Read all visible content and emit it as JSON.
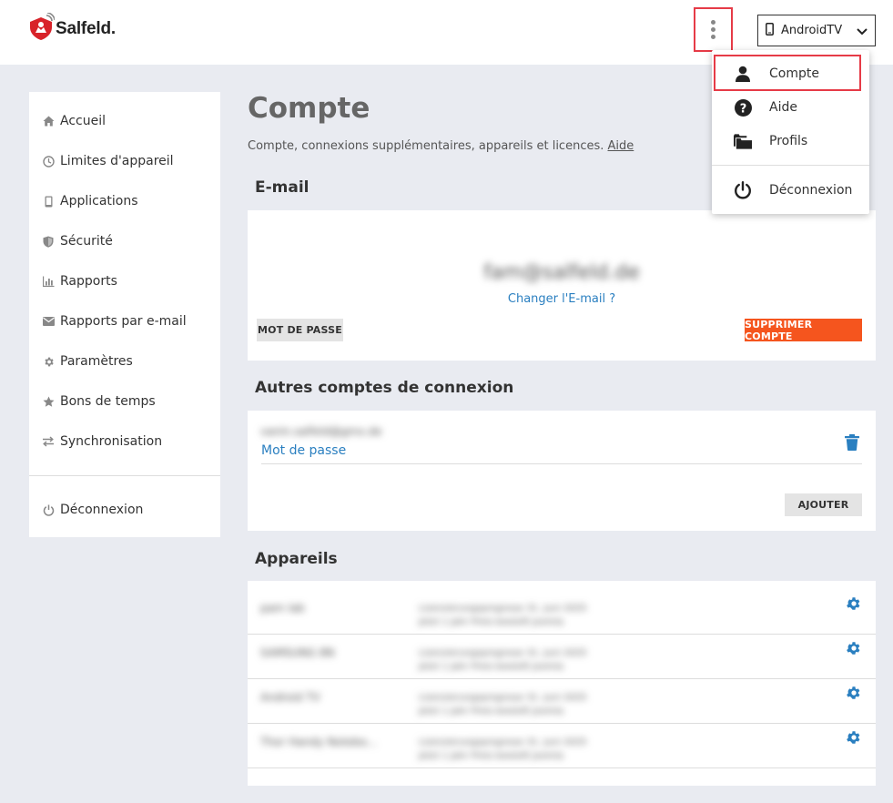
{
  "brand": {
    "name": "Salfeld."
  },
  "header": {
    "device_label": "AndroidTV"
  },
  "sidebar": {
    "items": [
      {
        "label": "Accueil",
        "icon": "home-icon"
      },
      {
        "label": "Limites d'appareil",
        "icon": "clock-icon"
      },
      {
        "label": "Applications",
        "icon": "phone-icon"
      },
      {
        "label": "Sécurité",
        "icon": "shield-icon"
      },
      {
        "label": "Rapports",
        "icon": "bar-chart-icon"
      },
      {
        "label": "Rapports par e-mail",
        "icon": "envelope-icon"
      },
      {
        "label": "Paramètres",
        "icon": "gear-icon"
      },
      {
        "label": "Bons de temps",
        "icon": "star-icon"
      },
      {
        "label": "Synchronisation",
        "icon": "sync-icon"
      }
    ],
    "logout": {
      "label": "Déconnexion",
      "icon": "power-icon"
    }
  },
  "main": {
    "title": "Compte",
    "subtitle": "Compte, connexions supplémentaires, appareils et licences.",
    "help_link": "Aide",
    "email_section": {
      "title": "E-mail",
      "email": "fam@salfeld.de",
      "change_email": "Changer l'E-mail ?",
      "password_button": "MOT DE PASSE",
      "delete_button": "SUPPRIMER COMPTE"
    },
    "other_accounts": {
      "title": "Autres comptes de connexion",
      "account_email": "vanin.salfeld@gmx.de",
      "password_link": "Mot de passe",
      "add_button": "AJOUTER"
    },
    "devices": {
      "title": "Appareils",
      "rows": [
        {
          "name": "pam lab",
          "line1": "Lizenzierungsprognose 31. Juni 2025",
          "line2": "Jetzt 1 Jahr Preis bestellt Joomla"
        },
        {
          "name": "SAMSUNG 8N",
          "line1": "Lizenzierungsprognose 31. Juni 2025",
          "line2": "Jetzt 1 Jahr Preis bestellt Joomla"
        },
        {
          "name": "Android TV",
          "line1": "Lizenzierungsprognose 31. Juni 2025",
          "line2": "Jetzt 1 Jahr Preis bestellt Joomla"
        },
        {
          "name": "Thor Handy Notebo...",
          "line1": "Lizenzierungsprognose 31. Juni 2025",
          "line2": "Jetzt 1 Jahr Preis bestellt Joomla"
        }
      ]
    }
  },
  "dropdown": {
    "items": [
      {
        "label": "Compte",
        "icon": "user-icon"
      },
      {
        "label": "Aide",
        "icon": "question-circle-icon"
      },
      {
        "label": "Profils",
        "icon": "folders-icon"
      }
    ],
    "logout": {
      "label": "Déconnexion",
      "icon": "power-icon"
    }
  },
  "colors": {
    "accent": "#2a7fc0",
    "danger": "#f5551e",
    "highlight": "#e63b47",
    "brand_red": "#d8232a"
  }
}
